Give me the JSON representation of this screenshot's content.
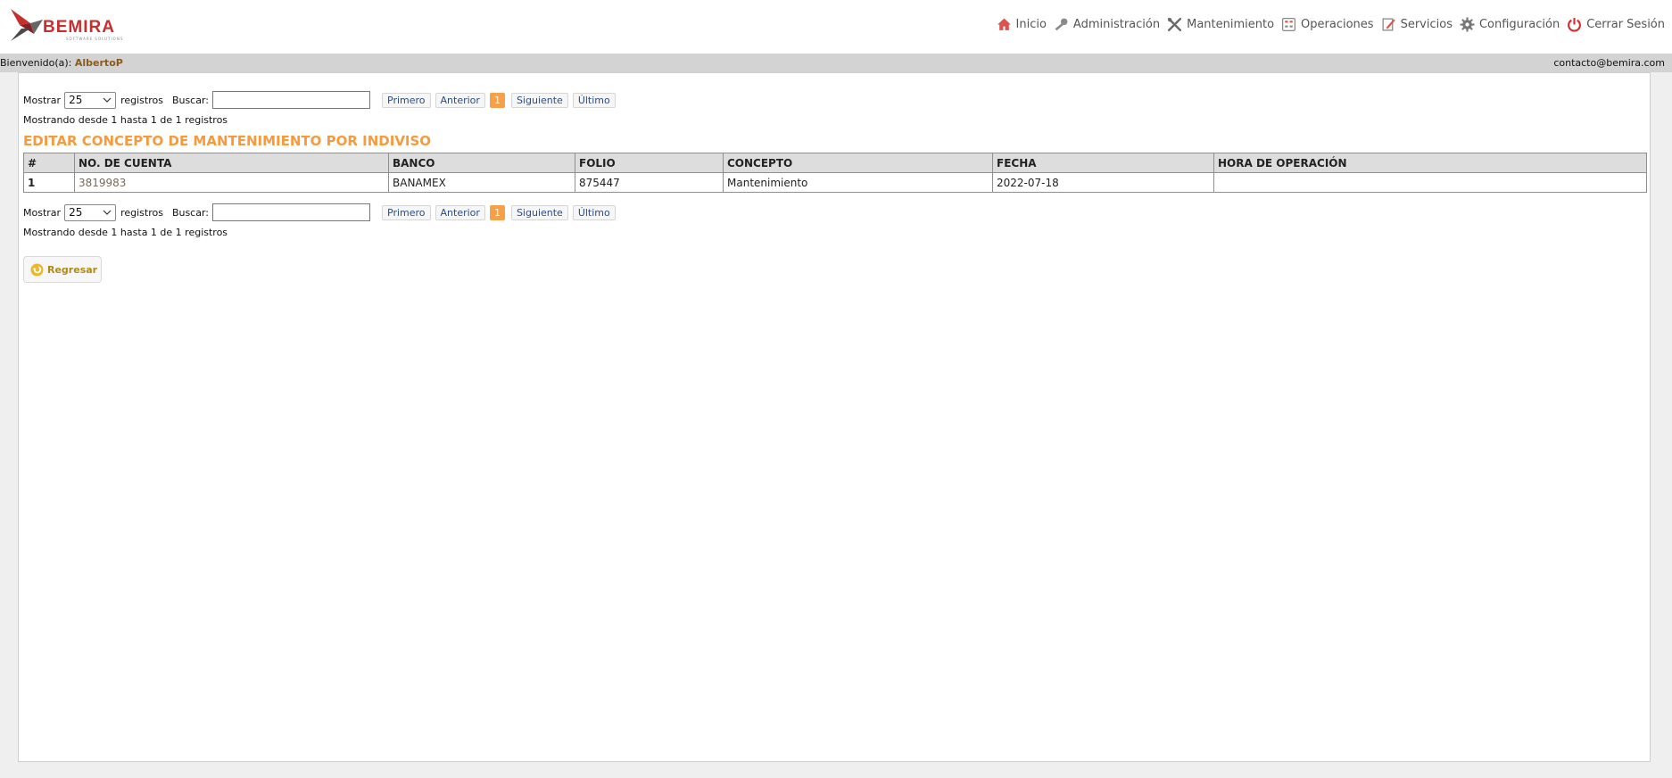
{
  "header": {
    "logo_text": "BEMIRA",
    "logo_subtext": "SOFTWARE SOLUTIONS",
    "nav": [
      {
        "label": "Inicio",
        "icon": "home-icon"
      },
      {
        "label": "Administración",
        "icon": "key-icon"
      },
      {
        "label": "Mantenimiento",
        "icon": "tools-icon"
      },
      {
        "label": "Operaciones",
        "icon": "calculator-icon"
      },
      {
        "label": "Servicios",
        "icon": "edit-document-icon"
      },
      {
        "label": "Configuración",
        "icon": "gear-icon"
      },
      {
        "label": "Cerrar Sesión",
        "icon": "power-icon"
      }
    ]
  },
  "welcome": {
    "prefix": "Bienvenido(a):",
    "user": "AlbertoP",
    "contact": "contacto@bemira.com"
  },
  "table_controls": {
    "show_label": "Mostrar",
    "page_size": "25",
    "records_label": "registros",
    "search_label": "Buscar:",
    "search_value": "",
    "pager": {
      "first": "Primero",
      "prev": "Anterior",
      "current": "1",
      "next": "Siguiente",
      "last": "Último"
    },
    "info": "Mostrando desde 1 hasta 1 de 1 registros"
  },
  "page_title": "EDITAR CONCEPTO DE MANTENIMIENTO POR INDIVISO",
  "table": {
    "columns": [
      "#",
      "NO. DE CUENTA",
      "BANCO",
      "FOLIO",
      "CONCEPTO",
      "FECHA",
      "HORA DE OPERACIÓN"
    ],
    "rows": [
      [
        "1",
        "3819983",
        "BANAMEX",
        "875447",
        "Mantenimiento",
        "2022-07-18",
        ""
      ]
    ]
  },
  "back_button": {
    "label": "Regresar"
  },
  "colors": {
    "accent": "#f59a3e",
    "brand": "#c72f2f",
    "user_name": "#8b5a1d",
    "back_label": "#b08a16"
  }
}
